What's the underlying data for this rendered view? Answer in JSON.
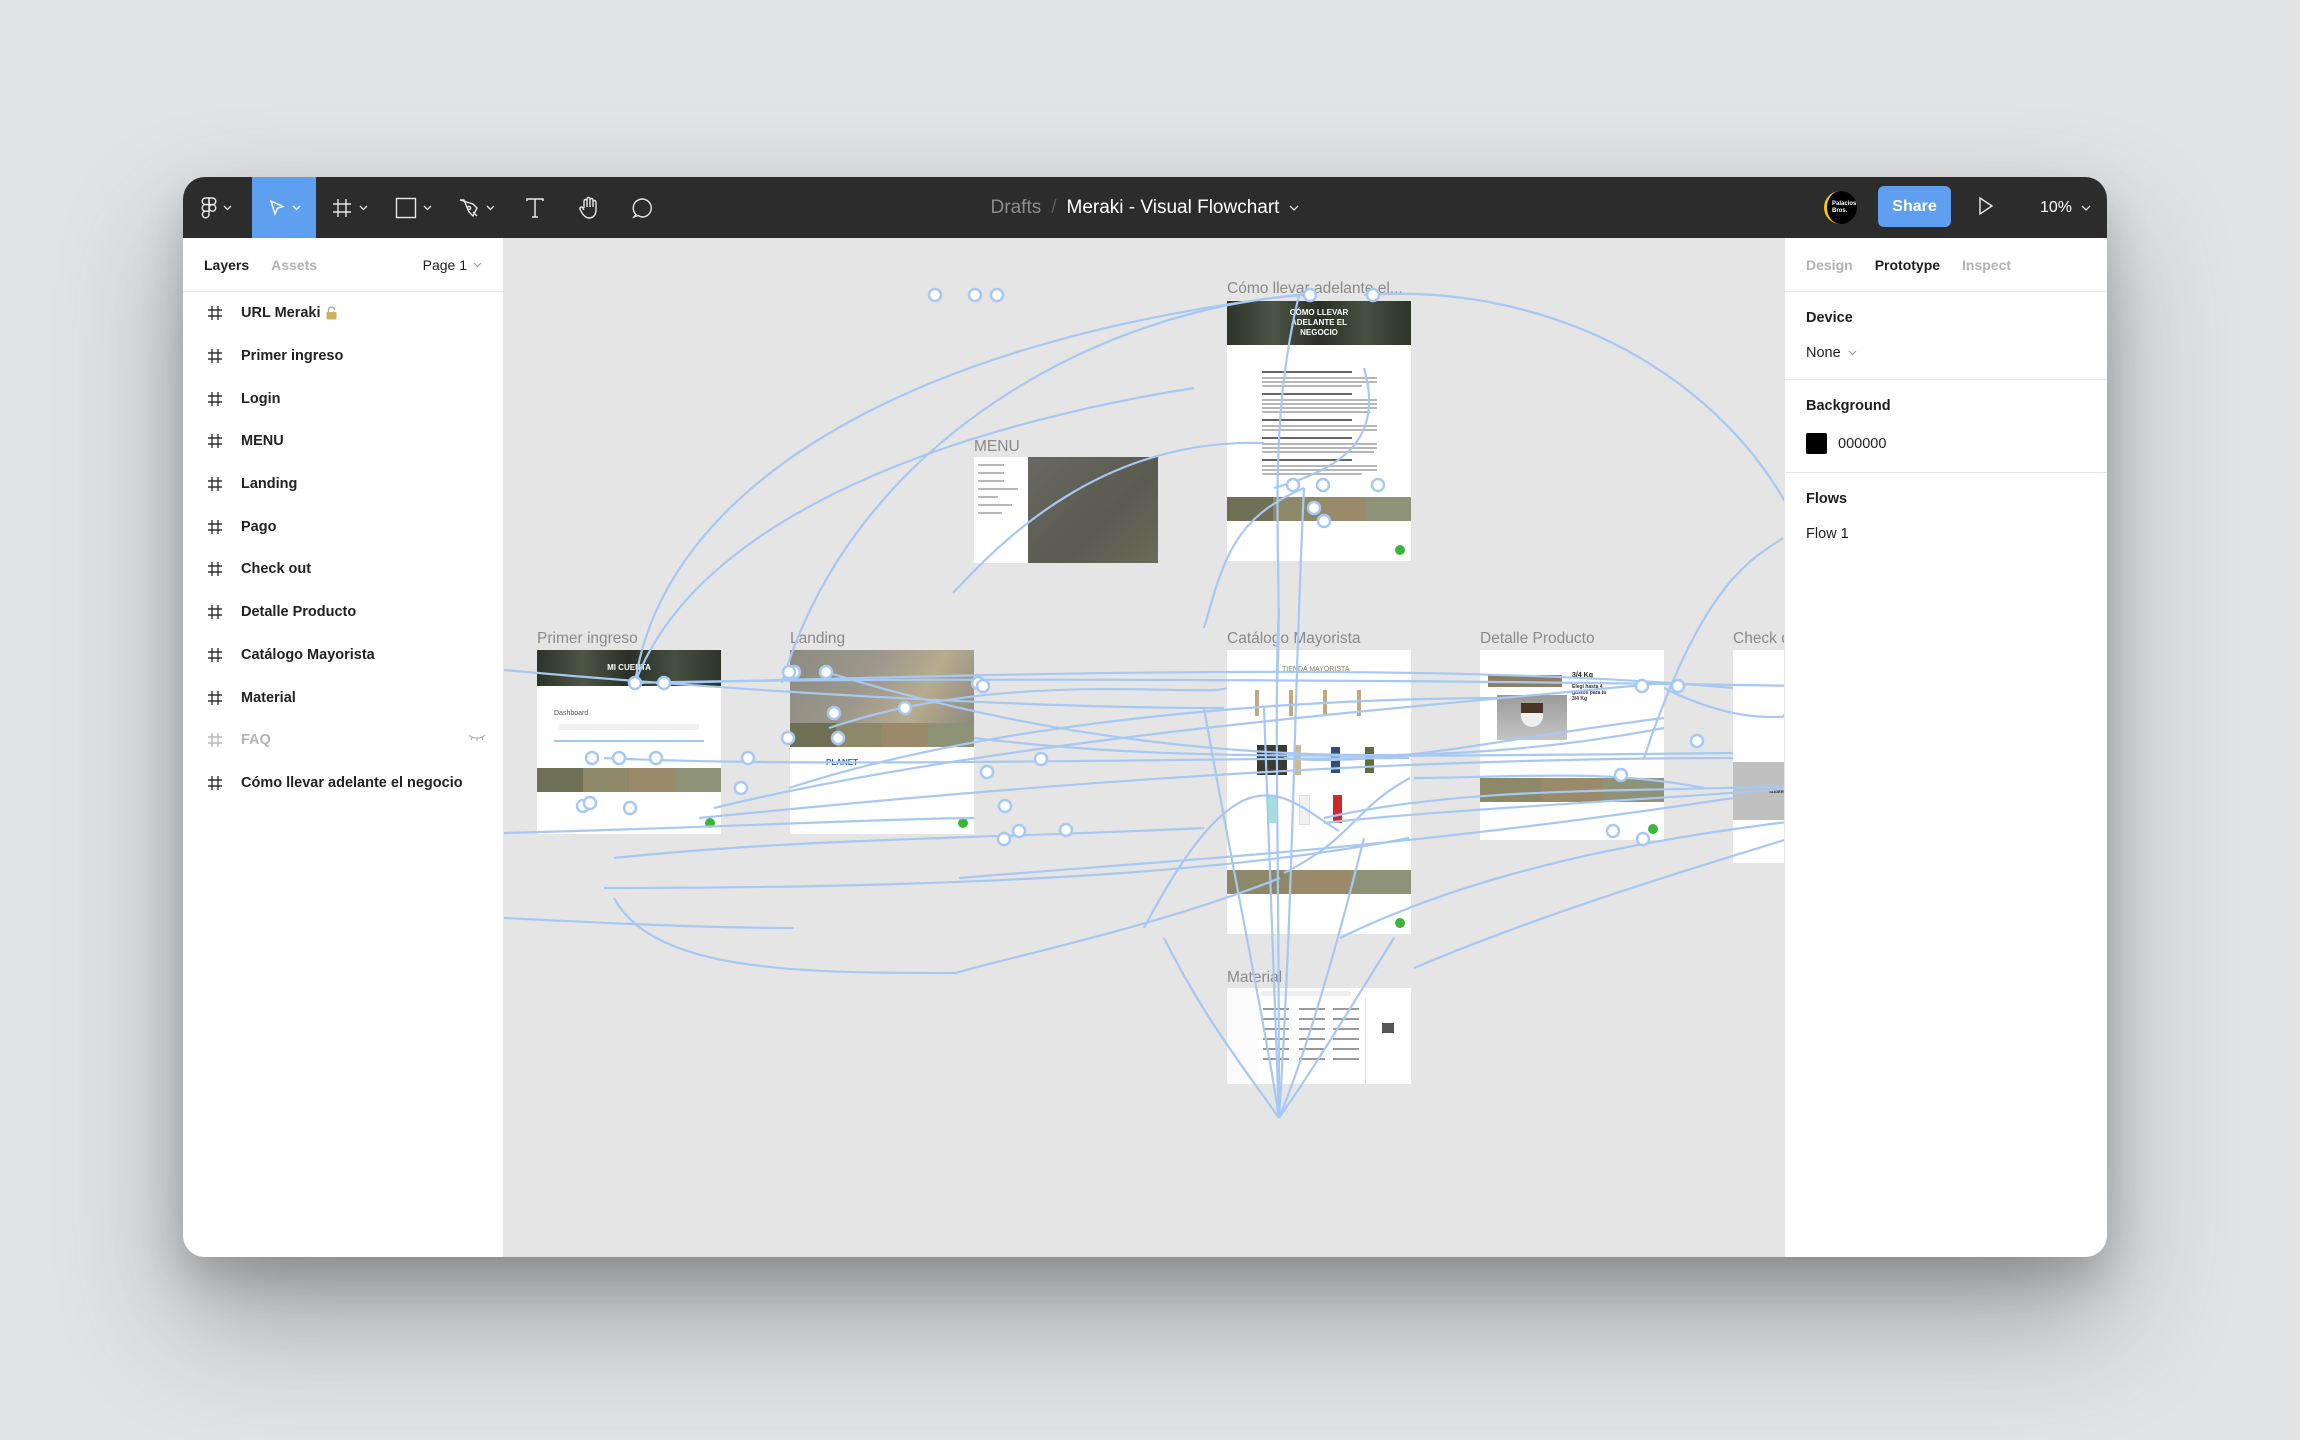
{
  "toolbar": {
    "tools": [
      {
        "name": "figma-menu",
        "icon": "figma-logo-icon",
        "active": false
      },
      {
        "name": "move",
        "icon": "cursor-arrow-icon",
        "active": true
      },
      {
        "name": "frame",
        "icon": "frame-hash-icon",
        "active": false
      },
      {
        "name": "shape",
        "icon": "rectangle-icon",
        "active": false
      },
      {
        "name": "pen",
        "icon": "pen-icon",
        "active": false
      },
      {
        "name": "text",
        "icon": "text-icon",
        "active": false
      },
      {
        "name": "hand",
        "icon": "hand-icon",
        "active": false
      },
      {
        "name": "comment",
        "icon": "comment-icon",
        "active": false
      }
    ],
    "breadcrumb_root": "Drafts",
    "breadcrumb_sep": "/",
    "file_title": "Meraki - Visual Flowchart",
    "avatar_text": "Palacios Bros.",
    "share_label": "Share",
    "zoom_level": "10%"
  },
  "left_panel": {
    "tabs": [
      {
        "label": "Layers",
        "active": true
      },
      {
        "label": "Assets",
        "active": false
      }
    ],
    "page_selector": "Page 1",
    "layers": [
      {
        "label": "URL Meraki",
        "locked": true,
        "hidden": false
      },
      {
        "label": "Primer ingreso",
        "locked": false,
        "hidden": false
      },
      {
        "label": "Login",
        "locked": false,
        "hidden": false
      },
      {
        "label": "MENU",
        "locked": false,
        "hidden": false
      },
      {
        "label": "Landing",
        "locked": false,
        "hidden": false
      },
      {
        "label": "Pago",
        "locked": false,
        "hidden": false
      },
      {
        "label": "Check out",
        "locked": false,
        "hidden": false
      },
      {
        "label": "Detalle Producto",
        "locked": false,
        "hidden": false
      },
      {
        "label": "Catálogo Mayorista",
        "locked": false,
        "hidden": false
      },
      {
        "label": "Material",
        "locked": false,
        "hidden": false
      },
      {
        "label": "FAQ",
        "locked": false,
        "hidden": true
      },
      {
        "label": "Cómo llevar adelante el negocio",
        "locked": false,
        "hidden": false
      }
    ]
  },
  "right_panel": {
    "tabs": [
      {
        "label": "Design",
        "active": false
      },
      {
        "label": "Prototype",
        "active": true
      },
      {
        "label": "Inspect",
        "active": false
      }
    ],
    "device": {
      "heading": "Device",
      "value": "None"
    },
    "background": {
      "heading": "Background",
      "hex": "000000",
      "color": "#000000"
    },
    "flows": {
      "heading": "Flows",
      "items": [
        "Flow 1"
      ]
    }
  },
  "canvas": {
    "background_color": "#e5e5e5",
    "connector_color": "#a6c8f2",
    "frames": [
      {
        "id": "como",
        "label": "Cómo llevar adelante el...",
        "hero_text": "CÓMO LLEVAR ADELANTE EL NEGOCIO"
      },
      {
        "id": "menu",
        "label": "MENU"
      },
      {
        "id": "primer",
        "label": "Primer ingreso",
        "hero_text": "MI CUENTA",
        "sub_heading": "Dashboard"
      },
      {
        "id": "landing",
        "label": "Landing",
        "partner": "PLANET"
      },
      {
        "id": "catalogo",
        "label": "Catálogo Mayorista",
        "heading": "TIENDA MAYORISTA"
      },
      {
        "id": "detalle",
        "label": "Detalle Producto",
        "product_title": "3/4 Kg",
        "product_desc": "Elegí hasta 4 gustos para tu 3/4 Kg"
      },
      {
        "id": "checkout",
        "label": "Check out",
        "slider_text": "SLIDER PRODUCTOS DESTACADOS O MÁS COMPRADOS"
      },
      {
        "id": "material",
        "label": "Material"
      }
    ]
  }
}
